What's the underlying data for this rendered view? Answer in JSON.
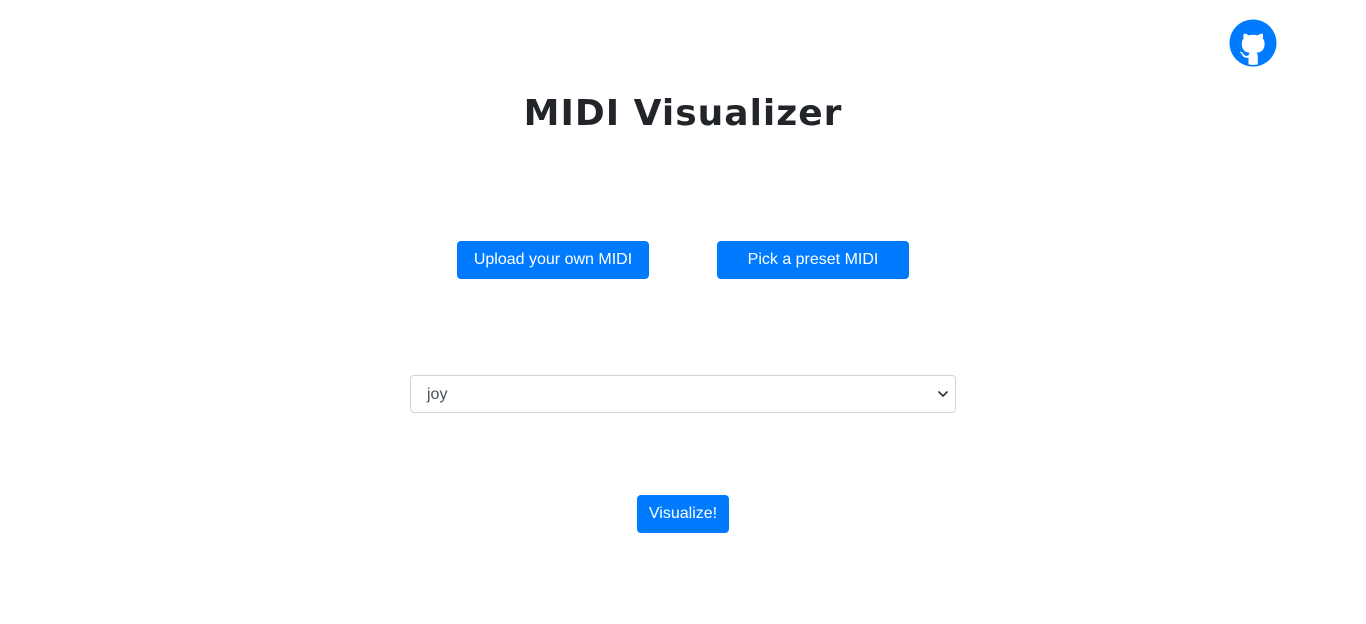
{
  "header": {
    "title": "MIDI Visualizer"
  },
  "icons": {
    "github": "github-icon",
    "select_arrow": "chevron-down-icon"
  },
  "colors": {
    "primary": "#007bff",
    "title": "#212529",
    "select_border": "#ced4da"
  },
  "buttons": {
    "upload_label": "Upload your own MIDI",
    "preset_label": "Pick a preset MIDI",
    "visualize_label": "Visualize!"
  },
  "preset_select": {
    "selected": "joy"
  }
}
